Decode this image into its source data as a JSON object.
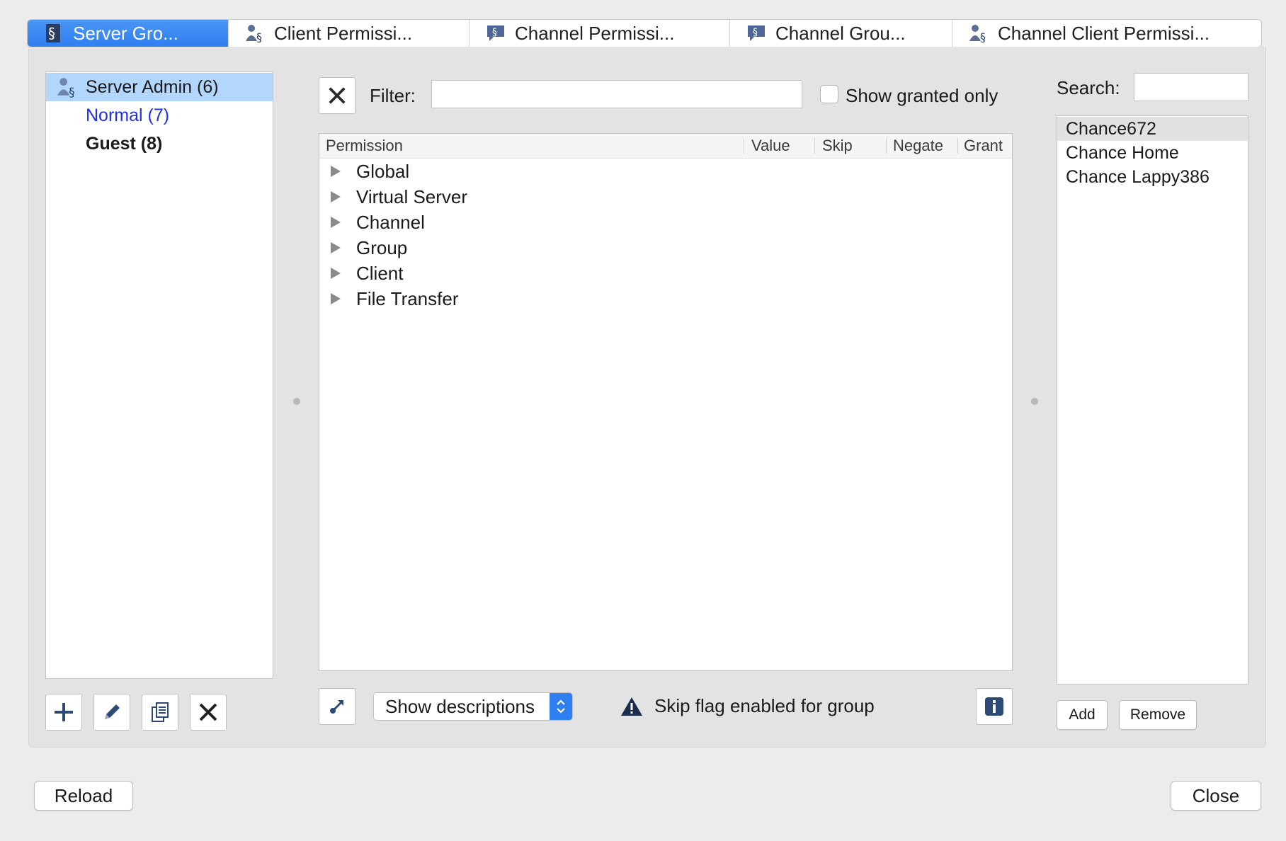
{
  "tabs": [
    {
      "label": "Server Gro...",
      "icon": "server-group-icon",
      "active": true
    },
    {
      "label": "Client Permissi...",
      "icon": "client-permission-icon",
      "active": false
    },
    {
      "label": "Channel Permissi...",
      "icon": "channel-permission-icon",
      "active": false
    },
    {
      "label": "Channel Grou...",
      "icon": "channel-group-icon",
      "active": false
    },
    {
      "label": "Channel Client Permissi...",
      "icon": "channel-client-permission-icon",
      "active": false
    }
  ],
  "groups": [
    {
      "label": "Server Admin (6)",
      "selected": true,
      "style": "normal",
      "icon": "user-group-icon"
    },
    {
      "label": "Normal (7)",
      "selected": false,
      "style": "blue"
    },
    {
      "label": "Guest (8)",
      "selected": false,
      "style": "bold"
    }
  ],
  "group_toolbar": {
    "add": "plus-icon",
    "rename": "pencil-icon",
    "copy": "copy-icon",
    "delete": "delete-x-icon"
  },
  "filter": {
    "label": "Filter:",
    "value": "",
    "show_granted_label": "Show granted only",
    "show_granted_checked": false
  },
  "permission_table": {
    "columns": [
      "Permission",
      "Value",
      "Skip",
      "Negate",
      "Grant"
    ],
    "rows": [
      "Global",
      "Virtual Server",
      "Channel",
      "Group",
      "Client",
      "File Transfer"
    ]
  },
  "bottom": {
    "descriptions_select": "Show descriptions",
    "warning_text": "Skip flag enabled for group",
    "info_icon": "info-icon"
  },
  "search": {
    "label": "Search:",
    "value": ""
  },
  "clients": [
    {
      "name": "Chance672",
      "selected": true
    },
    {
      "name": "Chance Home",
      "selected": false
    },
    {
      "name": "Chance Lappy386",
      "selected": false
    }
  ],
  "client_buttons": {
    "add": "Add",
    "remove": "Remove"
  },
  "footer": {
    "reload": "Reload",
    "close": "Close"
  },
  "colors": {
    "accent": "#2f7ff0",
    "selection": "#b3d6fd",
    "link_blue": "#1f2fe6",
    "warning_icon": "#1b2d4f"
  }
}
